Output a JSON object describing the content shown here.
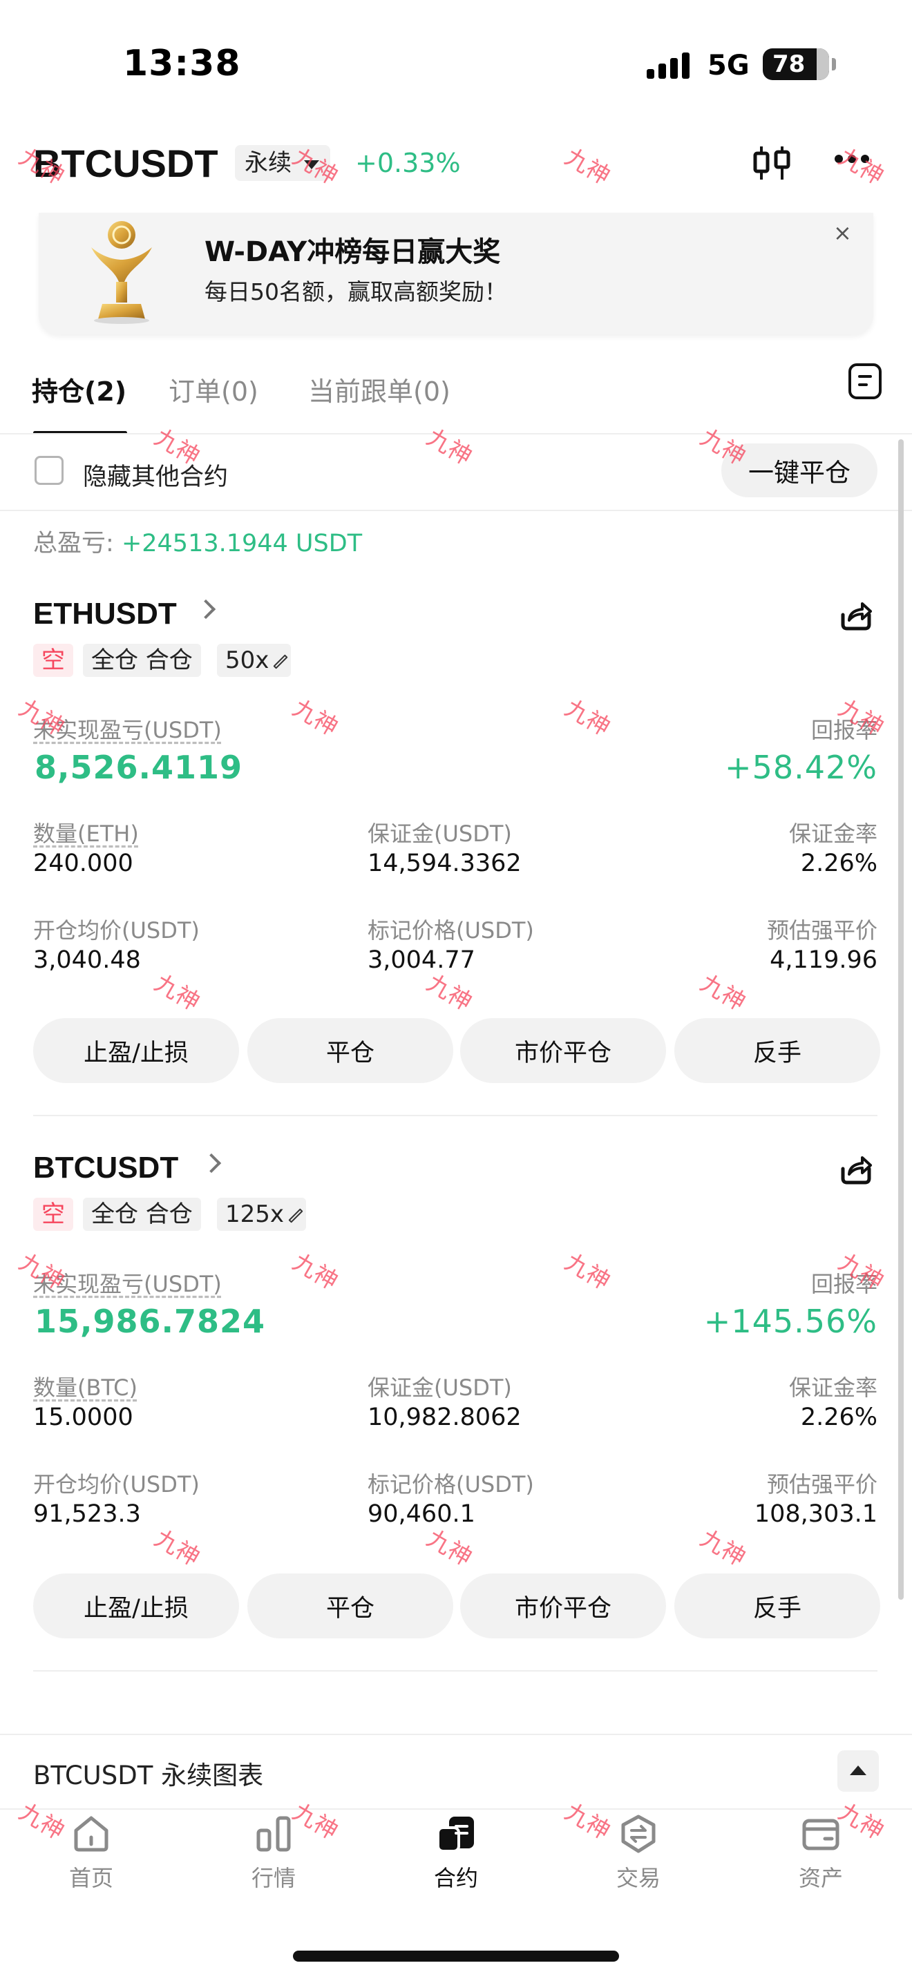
{
  "status_bar": {
    "time": "13:38",
    "network": "5G",
    "battery": "78"
  },
  "header": {
    "pair": "BTCUSDT",
    "contract_type": "永续",
    "change": "+0.33%"
  },
  "banner": {
    "title": "W-DAY冲榜每日赢大奖",
    "subtitle": "每日50名额，赢取高额奖励！",
    "close": "×"
  },
  "tabs": [
    {
      "label": "持仓(2)"
    },
    {
      "label": "订单(0)"
    },
    {
      "label": "当前跟单(0)"
    }
  ],
  "filter": {
    "hide_label": "隐藏其他合约",
    "close_all": "一键平仓"
  },
  "total_pnl": {
    "label": "总盈亏:",
    "value": "+24513.1944 USDT"
  },
  "positions": [
    {
      "symbol": "ETHUSDT",
      "side": "空",
      "margin_mode": "全仓 合仓",
      "leverage": "50x",
      "unrealized_label": "未实现盈亏(USDT)",
      "unrealized_value": "8,526.4119",
      "roe_label": "回报率",
      "roe_value": "+58.42%",
      "qty_label": "数量(ETH)",
      "qty_value": "240.000",
      "margin_label": "保证金(USDT)",
      "margin_value": "14,594.3362",
      "margin_ratio_label": "保证金率",
      "margin_ratio_value": "2.26%",
      "entry_label": "开仓均价(USDT)",
      "entry_value": "3,040.48",
      "mark_label": "标记价格(USDT)",
      "mark_value": "3,004.77",
      "liq_label": "预估强平价",
      "liq_value": "4,119.96"
    },
    {
      "symbol": "BTCUSDT",
      "side": "空",
      "margin_mode": "全仓 合仓",
      "leverage": "125x",
      "unrealized_label": "未实现盈亏(USDT)",
      "unrealized_value": "15,986.7824",
      "roe_label": "回报率",
      "roe_value": "+145.56%",
      "qty_label": "数量(BTC)",
      "qty_value": "15.0000",
      "margin_label": "保证金(USDT)",
      "margin_value": "10,982.8062",
      "margin_ratio_label": "保证金率",
      "margin_ratio_value": "2.26%",
      "entry_label": "开仓均价(USDT)",
      "entry_value": "91,523.3",
      "mark_label": "标记价格(USDT)",
      "mark_value": "90,460.1",
      "liq_label": "预估强平价",
      "liq_value": "108,303.1"
    }
  ],
  "actions": {
    "tp_sl": "止盈/止损",
    "close": "平仓",
    "market_close": "市价平仓",
    "reverse": "反手"
  },
  "chart_bar": {
    "label": "BTCUSDT 永续图表"
  },
  "bottom_nav": [
    {
      "label": "首页",
      "icon": "home-icon"
    },
    {
      "label": "行情",
      "icon": "market-bars-icon"
    },
    {
      "label": "合约",
      "icon": "futures-icon"
    },
    {
      "label": "交易",
      "icon": "trade-icon"
    },
    {
      "label": "资产",
      "icon": "wallet-icon"
    }
  ],
  "watermark": "九神",
  "colors": {
    "up": "#2ebd85",
    "short": "#f6465d",
    "text": "#111111",
    "muted": "#8a8a8a"
  }
}
